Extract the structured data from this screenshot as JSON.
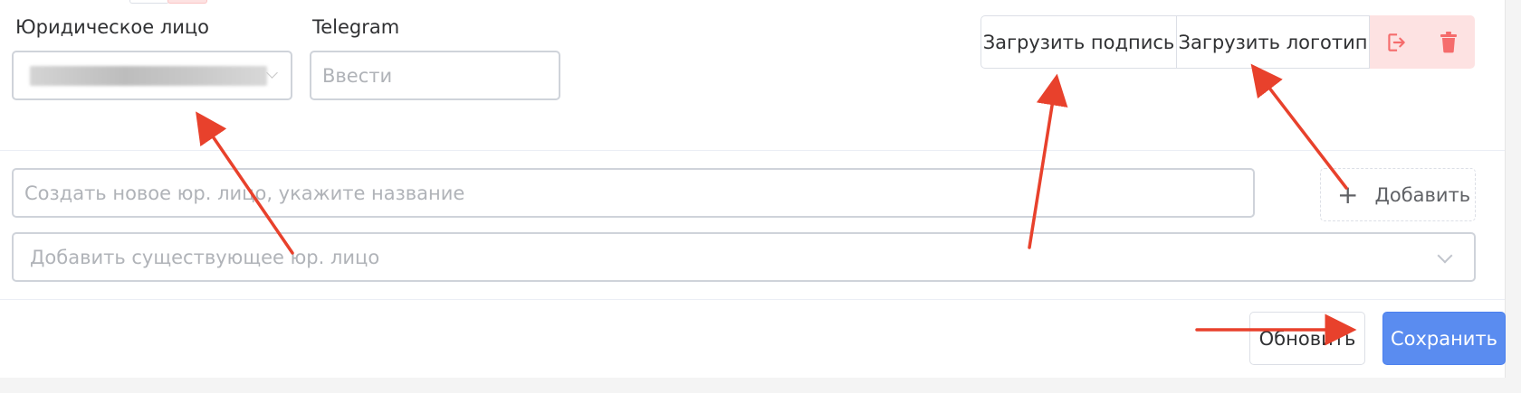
{
  "legal_entity": {
    "label": "Юридическое лицо",
    "value_redacted": true
  },
  "telegram": {
    "label": "Telegram",
    "placeholder": "Ввести"
  },
  "toolbar": {
    "upload_signature": "Загрузить подпись",
    "upload_logo": "Загрузить логотип",
    "logout_icon": "logout-icon",
    "delete_icon": "trash-icon",
    "danger_color": "#f56c6c"
  },
  "create_entity": {
    "placeholder": "Создать новое юр. лицо, укажите название",
    "add_label": "Добавить",
    "add_icon": "plus-icon"
  },
  "existing_entity": {
    "placeholder": "Добавить существующее юр. лицо"
  },
  "footer": {
    "refresh_label": "Обновить",
    "save_label": "Сохранить"
  },
  "colors": {
    "primary": "#5a8cf0",
    "annotation_arrow": "#e8412c",
    "danger_bg": "#fde2e2"
  }
}
